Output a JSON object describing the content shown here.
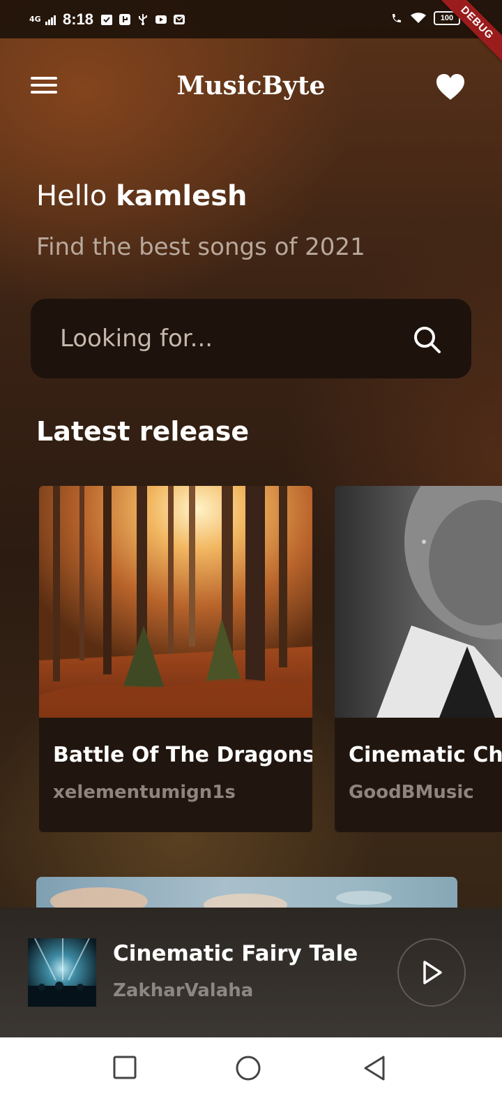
{
  "status_bar": {
    "network": "4G",
    "time": "8:18",
    "battery": "100",
    "debug_label": "DEBUG",
    "icons": [
      "signal-icon",
      "check-square-icon",
      "usb-debug-icon",
      "usb-icon",
      "youtube-icon",
      "mail-icon",
      "wifi-call-icon",
      "wifi-icon",
      "battery-icon"
    ]
  },
  "app_bar": {
    "title": "MusicByte",
    "menu_icon": "hamburger-menu-icon",
    "favorite_icon": "heart-icon"
  },
  "greeting": {
    "hello": "Hello",
    "name": "kamlesh",
    "subtitle": "Find the best songs of 2021"
  },
  "search": {
    "placeholder": "Looking for...",
    "value": "",
    "icon": "search-icon"
  },
  "latest_release": {
    "heading": "Latest release",
    "cards": [
      {
        "title": "Battle Of The Dragons",
        "artist": "xelementumign1s",
        "image": "autumn-forest-image"
      },
      {
        "title": "Cinematic Ch",
        "artist": "GoodBMusic",
        "image": "sad-man-bw-image"
      }
    ]
  },
  "now_playing": {
    "title": "Cinematic Fairy Tale",
    "artist": "ZakharValaha",
    "play_icon": "play-icon",
    "art": "concert-stage-image"
  },
  "nav_bar": {
    "buttons": [
      "recents-square-icon",
      "home-circle-icon",
      "back-triangle-icon"
    ]
  },
  "colors": {
    "background": "#3d2415",
    "search_bg": "#1d120c",
    "card_bg": "#21160f",
    "subtitle": "#b9a99c",
    "muted_text": "#8f857e",
    "debug_ribbon": "#9b1c1c"
  }
}
